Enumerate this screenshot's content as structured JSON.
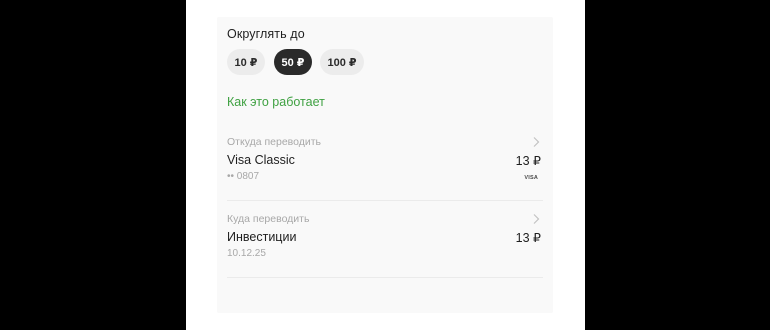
{
  "rounding": {
    "label": "Округлять до",
    "options": [
      "10 ₽",
      "50 ₽",
      "100 ₽"
    ],
    "selected": "50 ₽"
  },
  "how_link": "Как это работает",
  "from": {
    "caption": "Откуда переводить",
    "title": "Visa Classic",
    "subtitle": "•• 0807",
    "amount": "13 ₽",
    "card_brand": "VISA"
  },
  "to": {
    "caption": "Куда переводить",
    "title": "Инвестиции",
    "subtitle": "10.12.25",
    "amount": "13 ₽"
  },
  "colors": {
    "accent_green": "#3fa142",
    "chip_selected": "#2a2a2a",
    "chip_default": "#ececec"
  },
  "icons": [
    "chevron-right-icon",
    "visa-logo"
  ]
}
